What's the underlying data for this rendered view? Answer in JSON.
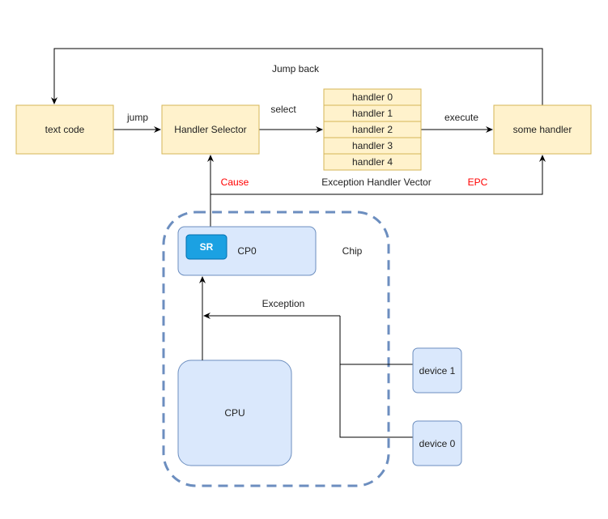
{
  "nodes": {
    "text_code": "text code",
    "handler_selector": "Handler Selector",
    "some_handler": "some handler",
    "handlers": [
      "handler 0",
      "handler 1",
      "handler 2",
      "handler 3",
      "handler 4"
    ],
    "vector_label": "Exception Handler Vector",
    "sr": "SR",
    "cp0": "CP0",
    "chip": "Chip",
    "cpu": "CPU",
    "device1": "device 1",
    "device0": "device 0"
  },
  "edges": {
    "jump_back": "Jump back",
    "jump": "jump",
    "select": "select",
    "execute": "execute",
    "cause": "Cause",
    "epc": "EPC",
    "exception": "Exception"
  },
  "colors": {
    "highlight": "#ff0000",
    "yellow_fill": "#fff2cc",
    "blue_fill": "#dae8fc",
    "sr_fill": "#1ba1e2"
  }
}
